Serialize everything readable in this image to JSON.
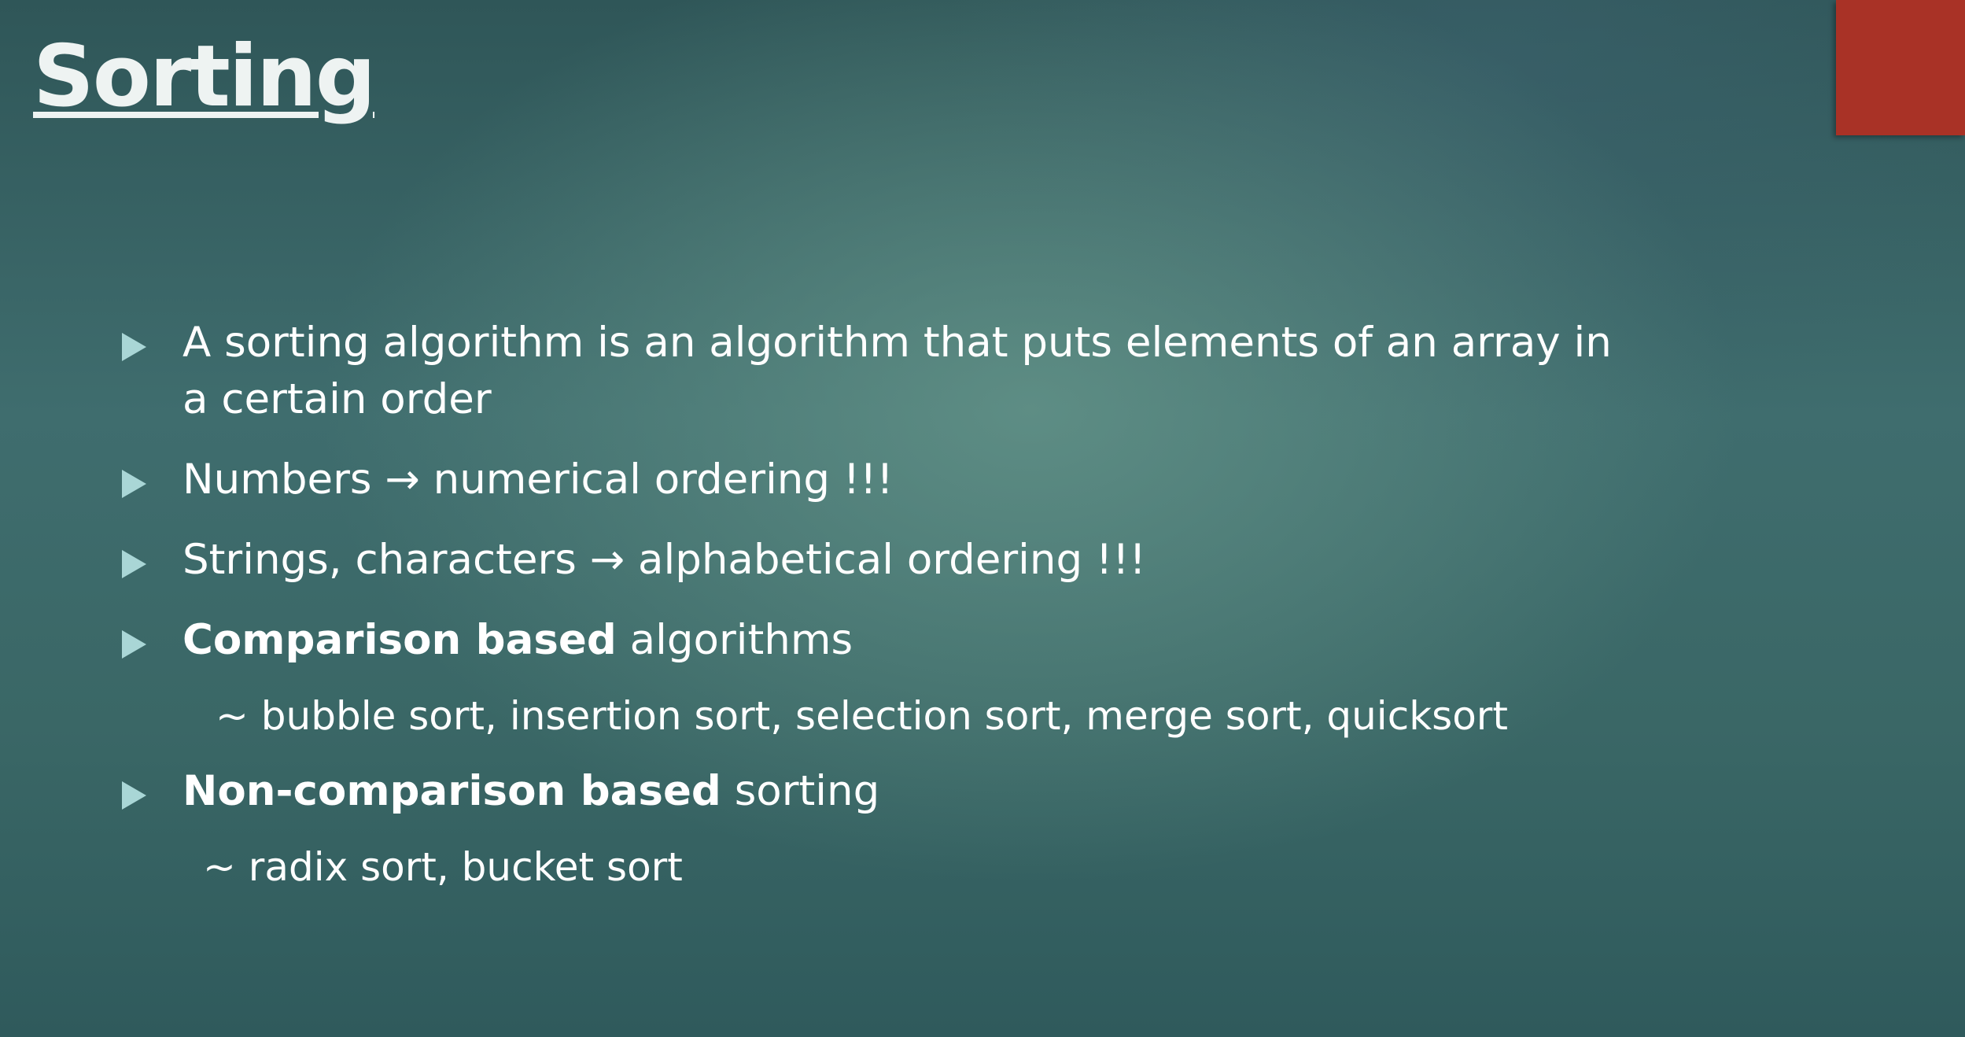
{
  "slide": {
    "title": "Sorting",
    "accent_color": "#a93226",
    "bullet_marker_color": "#a9d6d6",
    "bullets": [
      {
        "line1": "A sorting algorithm is an algorithm that puts elements of an array in",
        "line2": "a certain order"
      },
      {
        "text": "Numbers → numerical ordering !!!"
      },
      {
        "text": "Strings, characters → alphabetical ordering !!!"
      },
      {
        "bold": "Comparison based",
        "rest": " algorithms",
        "sub": "~ bubble sort, insertion sort, selection sort, merge sort, quicksort"
      },
      {
        "bold": "Non-comparison based",
        "rest": " sorting",
        "sub": "~ radix sort, bucket sort"
      }
    ]
  }
}
